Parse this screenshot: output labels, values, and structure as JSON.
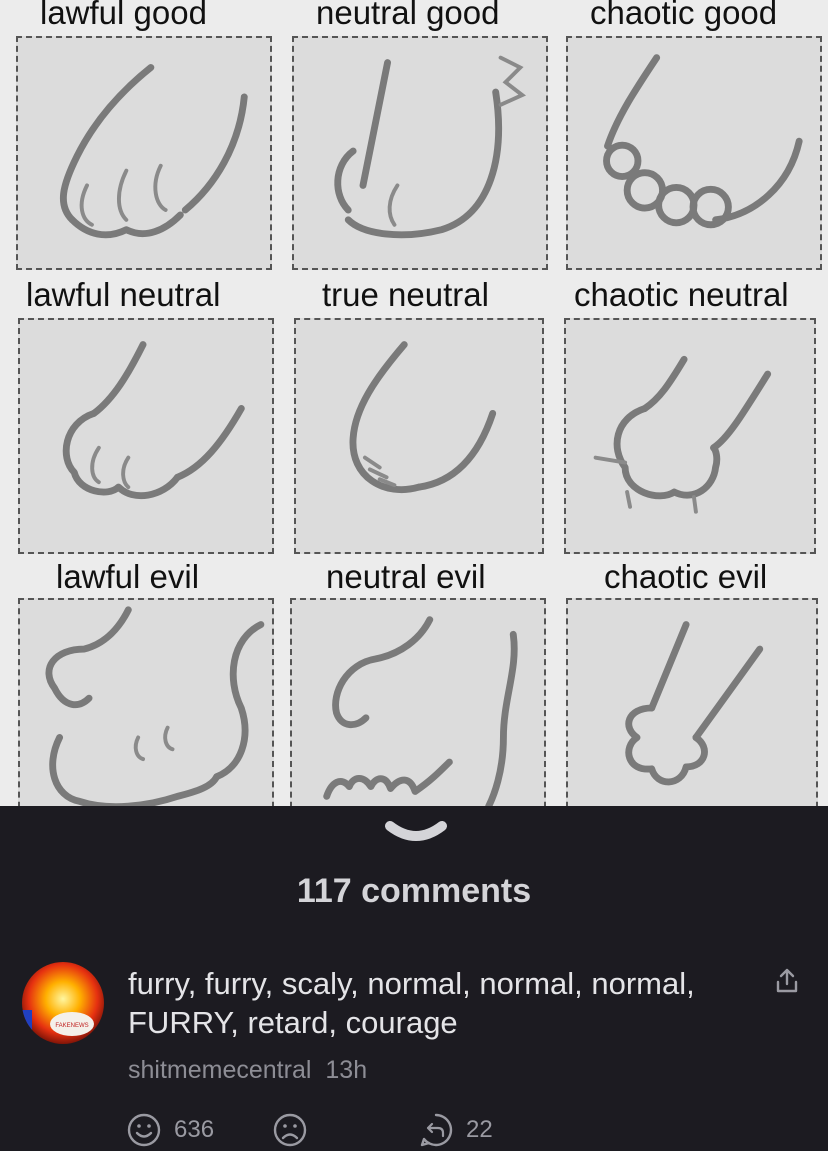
{
  "meme": {
    "labels": [
      "lawful good",
      "neutral good",
      "chaotic good",
      "lawful neutral",
      "true neutral",
      "chaotic neutral",
      "lawful evil",
      "neutral evil",
      "chaotic evil"
    ]
  },
  "comments_count": "117 comments",
  "comment": {
    "avatar_text": "FAKENEWS",
    "text": "furry, furry, scaly, normal, normal, normal, FURRY, retard, courage",
    "author": "shitmemecentral",
    "time": "13h"
  },
  "actions": {
    "upvote_count": "636",
    "reply_count": "22"
  },
  "colors": {
    "background": "#1c1b21",
    "text": "#e4e4e7",
    "muted": "#8d8d95"
  }
}
